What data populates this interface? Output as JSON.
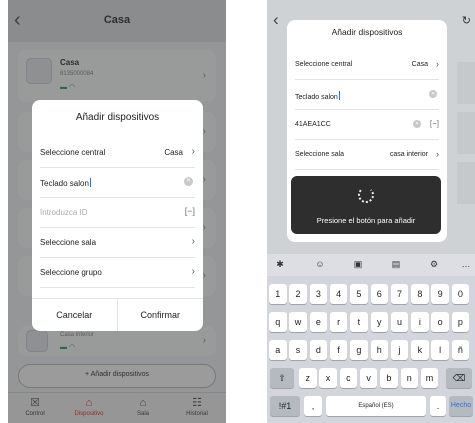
{
  "left_screen": {
    "header": {
      "title": "Casa",
      "back_icon": "chevron-left-icon"
    },
    "device_card": {
      "name": "Casa",
      "id": "8135000084"
    },
    "interior_card": {
      "label": "Casa interior"
    },
    "add_button": "+ Añadir dispositivos",
    "tabs": [
      {
        "label": "Control",
        "icon": "control-icon",
        "active": false
      },
      {
        "label": "Dispositivo",
        "icon": "bell-icon",
        "active": true
      },
      {
        "label": "Sala",
        "icon": "home-icon",
        "active": false
      },
      {
        "label": "Historial",
        "icon": "list-icon",
        "active": false
      }
    ],
    "modal": {
      "title": "Añadir dispositivos",
      "central_label": "Seleccione central",
      "central_value": "Casa",
      "name_value": "Teclado salon",
      "id_placeholder": "Introduzca ID",
      "room_label": "Seleccione sala",
      "group_label": "Seleccione grupo",
      "cancel": "Cancelar",
      "confirm": "Confirmar"
    }
  },
  "right_screen": {
    "modal": {
      "title": "Añadir dispositivos",
      "central_label": "Seleccione central",
      "central_value": "Casa",
      "name_value": "Teclado salon",
      "id_value": "41AEA1CC",
      "room_label": "Seleccione sala",
      "room_value": "casa interior"
    },
    "toast_text": "Presione el botón para añadir",
    "keyboard": {
      "row_numbers": [
        "1",
        "2",
        "3",
        "4",
        "5",
        "6",
        "7",
        "8",
        "9",
        "0"
      ],
      "row_q": [
        "q",
        "w",
        "e",
        "r",
        "t",
        "y",
        "u",
        "i",
        "o",
        "p"
      ],
      "row_a": [
        "a",
        "s",
        "d",
        "f",
        "g",
        "h",
        "j",
        "k",
        "l",
        "ñ"
      ],
      "row_z": [
        "z",
        "x",
        "c",
        "v",
        "b",
        "n",
        "m"
      ],
      "symbols_key": "!#1",
      "comma_key": ",",
      "space_label": "Español (ES)",
      "period_key": ".",
      "done_key": "Hecho"
    }
  }
}
